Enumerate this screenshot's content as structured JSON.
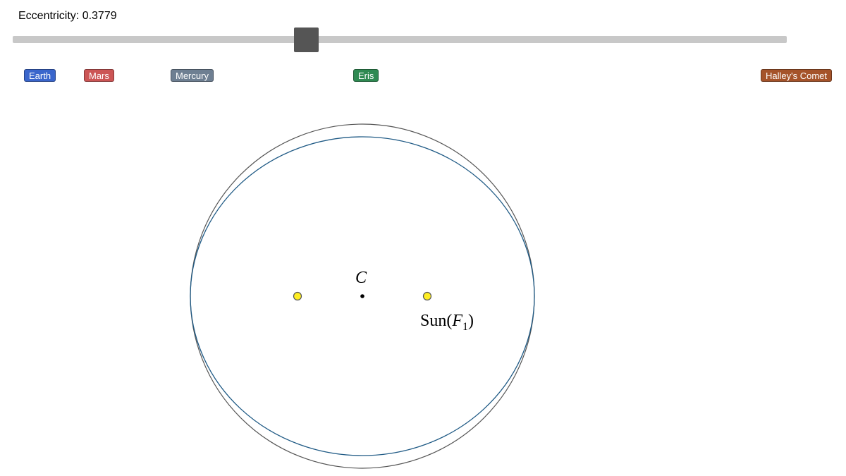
{
  "eccentricity": {
    "label": "Eccentricity: 0.3779",
    "value": 0.3779,
    "slider_fraction": 0.3779
  },
  "presets": [
    {
      "label": "Earth",
      "color": "#3a66cc"
    },
    {
      "label": "Mars",
      "color": "#cc5555"
    },
    {
      "label": "Mercury",
      "color": "#6e7f92"
    },
    {
      "label": "Eris",
      "color": "#2f8a52"
    },
    {
      "label": "Halley's Comet",
      "color": "#a5532a"
    }
  ],
  "diagram": {
    "center_label": "C",
    "sun_label_text": "Sun(",
    "sun_label_var": "F",
    "sun_label_sub": "1",
    "sun_label_close": ")",
    "colors": {
      "circle": "#555555",
      "ellipse": "#1f5a85",
      "focus_fill": "#ffee22",
      "focus_stroke": "#555555",
      "center_dot": "#000000"
    }
  }
}
